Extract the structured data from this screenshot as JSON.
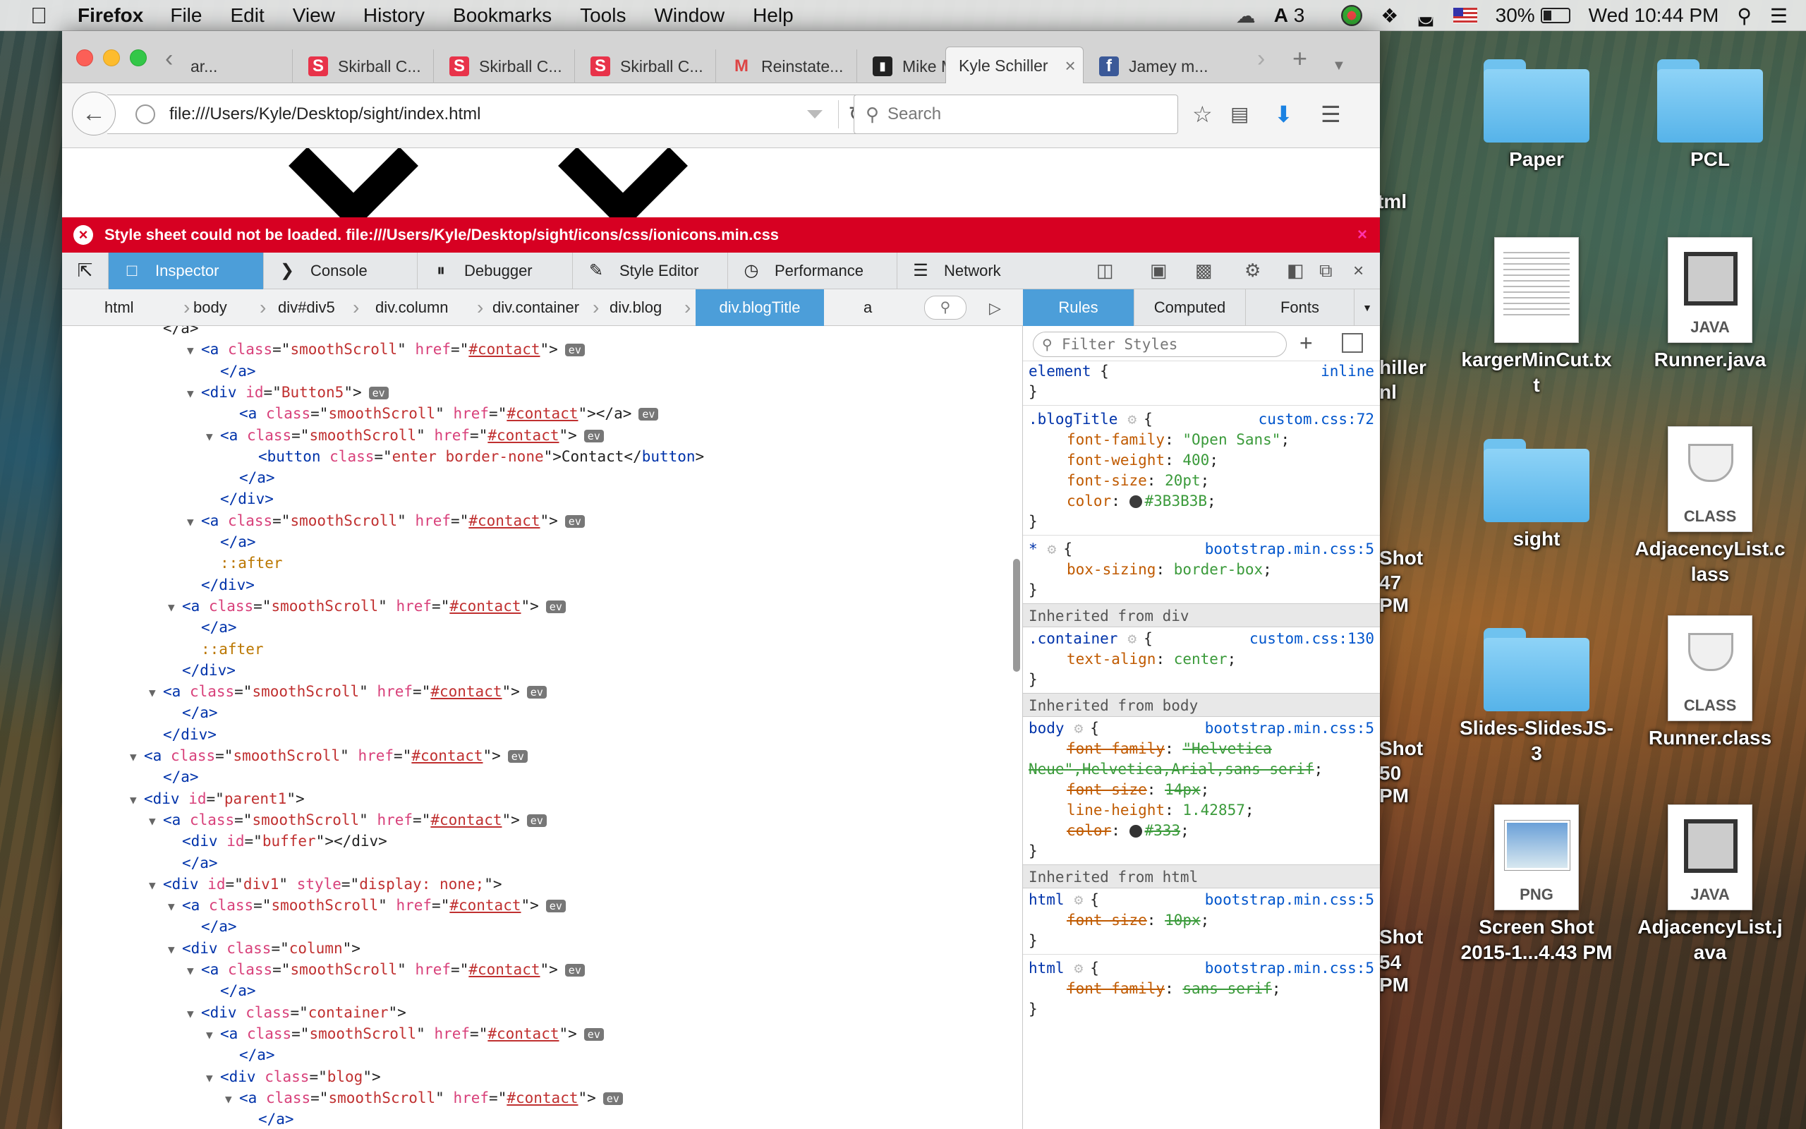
{
  "menubar": {
    "app": "Firefox",
    "items": [
      "File",
      "Edit",
      "View",
      "History",
      "Bookmarks",
      "Tools",
      "Window",
      "Help"
    ],
    "notif_count": "3",
    "battery": "30%",
    "clock": "Wed 10:44 PM"
  },
  "tabs": [
    {
      "label": "ar...",
      "icon": "partial-tab"
    },
    {
      "label": "Skirball C...",
      "icon": "skirball-s-icon"
    },
    {
      "label": "Skirball C...",
      "icon": "skirball-s-icon"
    },
    {
      "label": "Skirball C...",
      "icon": "skirball-s-icon"
    },
    {
      "label": "Reinstate...",
      "icon": "gmail-icon"
    },
    {
      "label": "Mike Mo...",
      "icon": "chat-icon"
    },
    {
      "label": "Kyle Schiller",
      "icon": "none",
      "active": true
    },
    {
      "label": "Jamey m...",
      "icon": "facebook-icon"
    }
  ],
  "urlbar": {
    "url": "file:///Users/Kyle/Desktop/sight/index.html"
  },
  "searchbar": {
    "placeholder": "Search"
  },
  "error": {
    "message": "Style sheet could not be loaded. file:///Users/Kyle/Desktop/sight/icons/css/ionicons.min.css"
  },
  "devtools": {
    "tabs": [
      "Inspector",
      "Console",
      "Debugger",
      "Style Editor",
      "Performance",
      "Network"
    ],
    "breadcrumbs": [
      "html",
      "body",
      "div#div5",
      "div.column",
      "div.container",
      "div.blog",
      "div.blogTitle",
      "a"
    ],
    "side_tabs": [
      "Rules",
      "Computed",
      "Fonts"
    ],
    "filter_placeholder": "Filter Styles"
  },
  "markup_lines": [
    {
      "indent": 1,
      "twisty": "",
      "parts": [
        [
          "plain",
          "</a>"
        ]
      ]
    },
    {
      "indent": 3,
      "twisty": "▼",
      "parts": [
        [
          "tag",
          "<a "
        ],
        [
          "an",
          "class"
        ],
        [
          "plain",
          "=\""
        ],
        [
          "av",
          "smoothScroll"
        ],
        [
          "plain",
          "\" "
        ],
        [
          "an",
          "href"
        ],
        [
          "plain",
          "=\""
        ],
        [
          "avl",
          "#contact"
        ],
        [
          "plain",
          "\">"
        ]
      ],
      "ev": true
    },
    {
      "indent": 4,
      "twisty": "",
      "parts": [
        [
          "tag",
          "</a>"
        ]
      ]
    },
    {
      "indent": 3,
      "twisty": "▼",
      "parts": [
        [
          "tag",
          "<div "
        ],
        [
          "an",
          "id"
        ],
        [
          "plain",
          "=\""
        ],
        [
          "av",
          "Button5"
        ],
        [
          "plain",
          "\">"
        ]
      ],
      "ev": true
    },
    {
      "indent": 5,
      "twisty": "",
      "parts": [
        [
          "tag",
          "<a "
        ],
        [
          "an",
          "class"
        ],
        [
          "plain",
          "=\""
        ],
        [
          "av",
          "smoothScroll"
        ],
        [
          "plain",
          "\" "
        ],
        [
          "an",
          "href"
        ],
        [
          "plain",
          "=\""
        ],
        [
          "avl",
          "#contact"
        ],
        [
          "plain",
          "\"></a>"
        ]
      ],
      "ev": true
    },
    {
      "indent": 4,
      "twisty": "▼",
      "parts": [
        [
          "tag",
          "<a "
        ],
        [
          "an",
          "class"
        ],
        [
          "plain",
          "=\""
        ],
        [
          "av",
          "smoothScroll"
        ],
        [
          "plain",
          "\" "
        ],
        [
          "an",
          "href"
        ],
        [
          "plain",
          "=\""
        ],
        [
          "avl",
          "#contact"
        ],
        [
          "plain",
          "\">"
        ]
      ],
      "ev": true
    },
    {
      "indent": 6,
      "twisty": "",
      "parts": [
        [
          "tag",
          "<button "
        ],
        [
          "an",
          "class"
        ],
        [
          "plain",
          "=\""
        ],
        [
          "av",
          "enter border-none"
        ],
        [
          "plain",
          "\">Contact</"
        ],
        [
          "tag",
          "button"
        ],
        [
          "plain",
          ">"
        ]
      ]
    },
    {
      "indent": 5,
      "twisty": "",
      "parts": [
        [
          "tag",
          "</a>"
        ]
      ]
    },
    {
      "indent": 4,
      "twisty": "",
      "parts": [
        [
          "tag",
          "</div>"
        ]
      ]
    },
    {
      "indent": 3,
      "twisty": "▼",
      "parts": [
        [
          "tag",
          "<a "
        ],
        [
          "an",
          "class"
        ],
        [
          "plain",
          "=\""
        ],
        [
          "av",
          "smoothScroll"
        ],
        [
          "plain",
          "\" "
        ],
        [
          "an",
          "href"
        ],
        [
          "plain",
          "=\""
        ],
        [
          "avl",
          "#contact"
        ],
        [
          "plain",
          "\">"
        ]
      ],
      "ev": true
    },
    {
      "indent": 4,
      "twisty": "",
      "parts": [
        [
          "tag",
          "</a>"
        ]
      ]
    },
    {
      "indent": 4,
      "twisty": "",
      "parts": [
        [
          "pe",
          "::after"
        ]
      ]
    },
    {
      "indent": 3,
      "twisty": "",
      "parts": [
        [
          "tag",
          "</div>"
        ]
      ]
    },
    {
      "indent": 2,
      "twisty": "▼",
      "parts": [
        [
          "tag",
          "<a "
        ],
        [
          "an",
          "class"
        ],
        [
          "plain",
          "=\""
        ],
        [
          "av",
          "smoothScroll"
        ],
        [
          "plain",
          "\" "
        ],
        [
          "an",
          "href"
        ],
        [
          "plain",
          "=\""
        ],
        [
          "avl",
          "#contact"
        ],
        [
          "plain",
          "\">"
        ]
      ],
      "ev": true
    },
    {
      "indent": 3,
      "twisty": "",
      "parts": [
        [
          "tag",
          "</a>"
        ]
      ]
    },
    {
      "indent": 3,
      "twisty": "",
      "parts": [
        [
          "pe",
          "::after"
        ]
      ]
    },
    {
      "indent": 2,
      "twisty": "",
      "parts": [
        [
          "tag",
          "</div>"
        ]
      ]
    },
    {
      "indent": 1,
      "twisty": "▼",
      "parts": [
        [
          "tag",
          "<a "
        ],
        [
          "an",
          "class"
        ],
        [
          "plain",
          "=\""
        ],
        [
          "av",
          "smoothScroll"
        ],
        [
          "plain",
          "\" "
        ],
        [
          "an",
          "href"
        ],
        [
          "plain",
          "=\""
        ],
        [
          "avl",
          "#contact"
        ],
        [
          "plain",
          "\">"
        ]
      ],
      "ev": true
    },
    {
      "indent": 2,
      "twisty": "",
      "parts": [
        [
          "tag",
          "</a>"
        ]
      ]
    },
    {
      "indent": 1,
      "twisty": "",
      "parts": [
        [
          "tag",
          "</div>"
        ]
      ]
    },
    {
      "indent": 0,
      "twisty": "▼",
      "parts": [
        [
          "tag",
          "<a "
        ],
        [
          "an",
          "class"
        ],
        [
          "plain",
          "=\""
        ],
        [
          "av",
          "smoothScroll"
        ],
        [
          "plain",
          "\" "
        ],
        [
          "an",
          "href"
        ],
        [
          "plain",
          "=\""
        ],
        [
          "avl",
          "#contact"
        ],
        [
          "plain",
          "\">"
        ]
      ],
      "ev": true
    },
    {
      "indent": 1,
      "twisty": "",
      "parts": [
        [
          "tag",
          "</a>"
        ]
      ]
    },
    {
      "indent": 0,
      "twisty": "▼",
      "parts": [
        [
          "tag",
          "<div "
        ],
        [
          "an",
          "id"
        ],
        [
          "plain",
          "=\""
        ],
        [
          "av",
          "parent1"
        ],
        [
          "plain",
          "\">"
        ]
      ]
    },
    {
      "indent": 1,
      "twisty": "▼",
      "parts": [
        [
          "tag",
          "<a "
        ],
        [
          "an",
          "class"
        ],
        [
          "plain",
          "=\""
        ],
        [
          "av",
          "smoothScroll"
        ],
        [
          "plain",
          "\" "
        ],
        [
          "an",
          "href"
        ],
        [
          "plain",
          "=\""
        ],
        [
          "avl",
          "#contact"
        ],
        [
          "plain",
          "\">"
        ]
      ],
      "ev": true
    },
    {
      "indent": 2,
      "twisty": "",
      "parts": [
        [
          "tag",
          "<div "
        ],
        [
          "an",
          "id"
        ],
        [
          "plain",
          "=\""
        ],
        [
          "av",
          "buffer"
        ],
        [
          "plain",
          "\"></div>"
        ]
      ]
    },
    {
      "indent": 2,
      "twisty": "",
      "parts": [
        [
          "tag",
          "</a>"
        ]
      ]
    },
    {
      "indent": 1,
      "twisty": "▼",
      "parts": [
        [
          "tag",
          "<div "
        ],
        [
          "an",
          "id"
        ],
        [
          "plain",
          "=\""
        ],
        [
          "av",
          "div1"
        ],
        [
          "plain",
          "\" "
        ],
        [
          "an",
          "style"
        ],
        [
          "plain",
          "=\""
        ],
        [
          "av",
          "display: none;"
        ],
        [
          "plain",
          "\">"
        ]
      ]
    },
    {
      "indent": 2,
      "twisty": "▼",
      "parts": [
        [
          "tag",
          "<a "
        ],
        [
          "an",
          "class"
        ],
        [
          "plain",
          "=\""
        ],
        [
          "av",
          "smoothScroll"
        ],
        [
          "plain",
          "\" "
        ],
        [
          "an",
          "href"
        ],
        [
          "plain",
          "=\""
        ],
        [
          "avl",
          "#contact"
        ],
        [
          "plain",
          "\">"
        ]
      ],
      "ev": true
    },
    {
      "indent": 3,
      "twisty": "",
      "parts": [
        [
          "tag",
          "</a>"
        ]
      ]
    },
    {
      "indent": 2,
      "twisty": "▼",
      "parts": [
        [
          "tag",
          "<div "
        ],
        [
          "an",
          "class"
        ],
        [
          "plain",
          "=\""
        ],
        [
          "av",
          "column"
        ],
        [
          "plain",
          "\">"
        ]
      ]
    },
    {
      "indent": 3,
      "twisty": "▼",
      "parts": [
        [
          "tag",
          "<a "
        ],
        [
          "an",
          "class"
        ],
        [
          "plain",
          "=\""
        ],
        [
          "av",
          "smoothScroll"
        ],
        [
          "plain",
          "\" "
        ],
        [
          "an",
          "href"
        ],
        [
          "plain",
          "=\""
        ],
        [
          "avl",
          "#contact"
        ],
        [
          "plain",
          "\">"
        ]
      ],
      "ev": true
    },
    {
      "indent": 4,
      "twisty": "",
      "parts": [
        [
          "tag",
          "</a>"
        ]
      ]
    },
    {
      "indent": 3,
      "twisty": "▼",
      "parts": [
        [
          "tag",
          "<div "
        ],
        [
          "an",
          "class"
        ],
        [
          "plain",
          "=\""
        ],
        [
          "av",
          "container"
        ],
        [
          "plain",
          "\">"
        ]
      ]
    },
    {
      "indent": 4,
      "twisty": "▼",
      "parts": [
        [
          "tag",
          "<a "
        ],
        [
          "an",
          "class"
        ],
        [
          "plain",
          "=\""
        ],
        [
          "av",
          "smoothScroll"
        ],
        [
          "plain",
          "\" "
        ],
        [
          "an",
          "href"
        ],
        [
          "plain",
          "=\""
        ],
        [
          "avl",
          "#contact"
        ],
        [
          "plain",
          "\">"
        ]
      ],
      "ev": true
    },
    {
      "indent": 5,
      "twisty": "",
      "parts": [
        [
          "tag",
          "</a>"
        ]
      ]
    },
    {
      "indent": 4,
      "twisty": "▼",
      "parts": [
        [
          "tag",
          "<div "
        ],
        [
          "an",
          "class"
        ],
        [
          "plain",
          "=\""
        ],
        [
          "av",
          "blog"
        ],
        [
          "plain",
          "\">"
        ]
      ]
    },
    {
      "indent": 5,
      "twisty": "▼",
      "parts": [
        [
          "tag",
          "<a "
        ],
        [
          "an",
          "class"
        ],
        [
          "plain",
          "=\""
        ],
        [
          "av",
          "smoothScroll"
        ],
        [
          "plain",
          "\" "
        ],
        [
          "an",
          "href"
        ],
        [
          "plain",
          "=\""
        ],
        [
          "avl",
          "#contact"
        ],
        [
          "plain",
          "\">"
        ]
      ],
      "ev": true
    },
    {
      "indent": 6,
      "twisty": "",
      "parts": [
        [
          "tag",
          "</a>"
        ]
      ]
    }
  ],
  "rules": [
    {
      "kind": "rule",
      "selector": "element",
      "brace": " {",
      "source": "inline"
    },
    {
      "kind": "close"
    },
    {
      "kind": "sep"
    },
    {
      "kind": "rule",
      "selector": ".blogTitle",
      "gear": true,
      "brace": " {",
      "source": "custom.css:72"
    },
    {
      "kind": "prop",
      "name": "font-family",
      "value": "\"Open Sans\"",
      "semi": ";"
    },
    {
      "kind": "prop",
      "name": "font-weight",
      "value": "400",
      "semi": ";"
    },
    {
      "kind": "prop",
      "name": "font-size",
      "value": "20pt",
      "semi": ";"
    },
    {
      "kind": "prop",
      "name": "color",
      "value": "#3B3B3B",
      "swatch": "#3B3B3B",
      "semi": ";"
    },
    {
      "kind": "close"
    },
    {
      "kind": "sep"
    },
    {
      "kind": "rule",
      "selector": "*",
      "gear": true,
      "brace": " {",
      "source": "bootstrap.min.css:5"
    },
    {
      "kind": "prop",
      "name": "box-sizing",
      "value": "border-box",
      "semi": ";"
    },
    {
      "kind": "close"
    },
    {
      "kind": "inherit",
      "label": "Inherited from div"
    },
    {
      "kind": "rule",
      "selector": ".container",
      "gear": true,
      "brace": " {",
      "source": "custom.css:130"
    },
    {
      "kind": "prop",
      "name": "text-align",
      "value": "center",
      "semi": ";"
    },
    {
      "kind": "close"
    },
    {
      "kind": "inherit",
      "label": "Inherited from body"
    },
    {
      "kind": "rule",
      "selector": "body",
      "gear": true,
      "brace": " {",
      "source": "bootstrap.min.css:5"
    },
    {
      "kind": "prop",
      "name": "font-family",
      "value": "\"Helvetica",
      "semi": "",
      "strike": true
    },
    {
      "kind": "propcont",
      "value": "Neue\",Helvetica,Arial,sans-serif",
      "semi": ";",
      "strike": true
    },
    {
      "kind": "prop",
      "name": "font-size",
      "value": "14px",
      "semi": ";",
      "strike": true
    },
    {
      "kind": "prop",
      "name": "line-height",
      "value": "1.42857",
      "semi": ";"
    },
    {
      "kind": "prop",
      "name": "color",
      "value": "#333",
      "swatch": "#333333",
      "semi": ";",
      "strike": true
    },
    {
      "kind": "close"
    },
    {
      "kind": "inherit",
      "label": "Inherited from html"
    },
    {
      "kind": "rule",
      "selector": "html",
      "gear": true,
      "brace": " {",
      "source": "bootstrap.min.css:5"
    },
    {
      "kind": "prop",
      "name": "font-size",
      "value": "10px",
      "semi": ";",
      "strike": true
    },
    {
      "kind": "close"
    },
    {
      "kind": "sep"
    },
    {
      "kind": "rule",
      "selector": "html",
      "gear": true,
      "brace": " {",
      "source": "bootstrap.min.css:5"
    },
    {
      "kind": "prop",
      "name": "font-family",
      "value": "sans-serif",
      "semi": ";",
      "strike": true
    },
    {
      "kind": "close"
    }
  ],
  "desktop": {
    "partial_labels": [
      "html",
      "hiller",
      "nl",
      "Shot",
      "47 PM",
      "Shot",
      "50 PM",
      "Shot",
      "54 PM"
    ],
    "icons": [
      {
        "label": "Paper",
        "kind": "folder"
      },
      {
        "label": "PCL",
        "kind": "folder"
      },
      {
        "label": "kargerMinCut.txt",
        "kind": "txt"
      },
      {
        "label": "Runner.java",
        "kind": "java",
        "badge": "JAVA"
      },
      {
        "label": "sight",
        "kind": "folder"
      },
      {
        "label": "AdjacencyList.class",
        "kind": "class",
        "badge": "CLASS"
      },
      {
        "label": "Slides-SlidesJS-3",
        "kind": "folder"
      },
      {
        "label": "Runner.class",
        "kind": "class",
        "badge": "CLASS"
      },
      {
        "label": "Screen Shot 2015-1...4.43 PM",
        "kind": "png",
        "badge": "PNG"
      },
      {
        "label": "AdjacencyList.java",
        "kind": "java",
        "badge": "JAVA"
      }
    ]
  },
  "colors": {
    "accent": "#4c9ed9",
    "error": "#d70022"
  }
}
